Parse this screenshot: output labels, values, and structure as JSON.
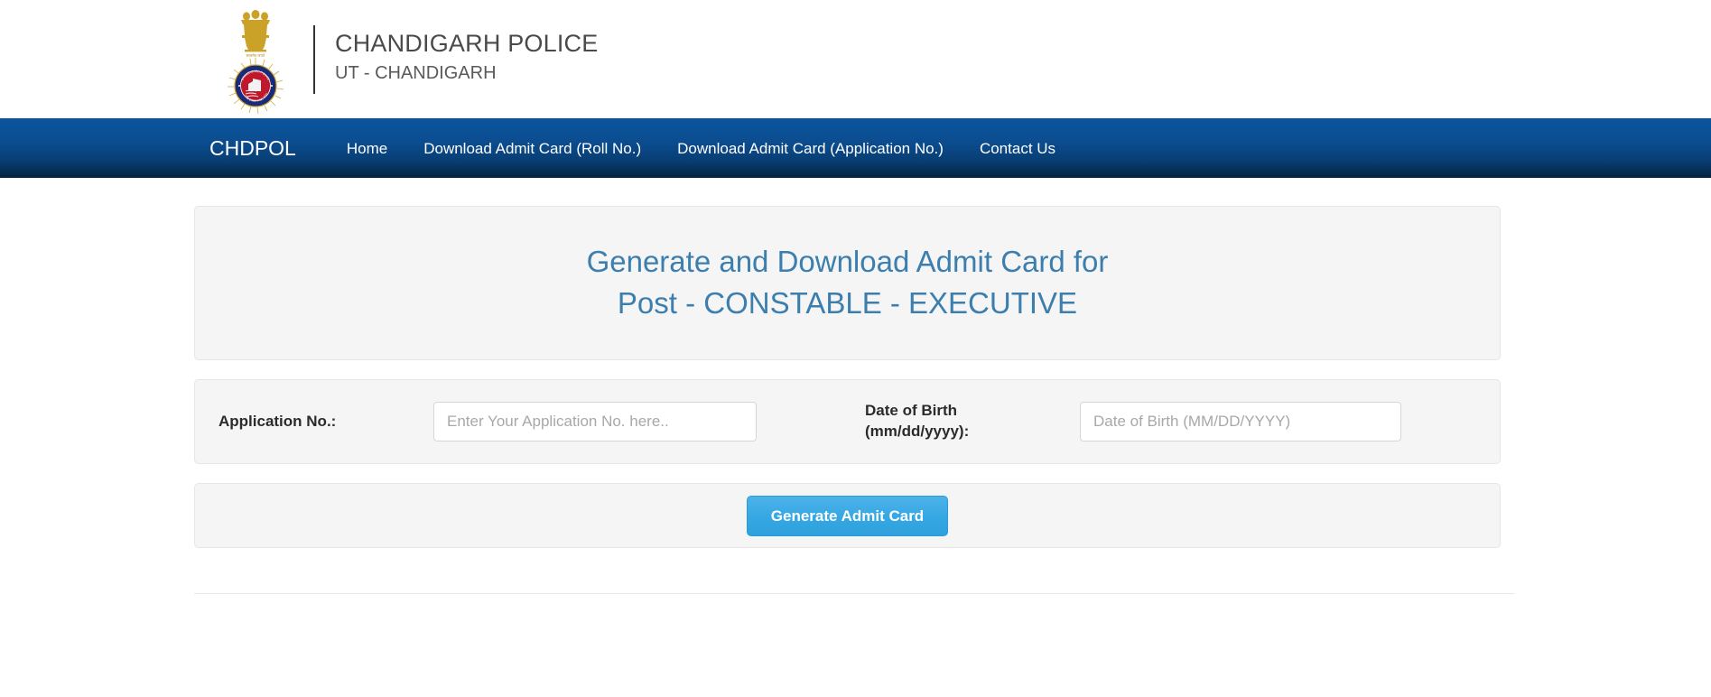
{
  "header": {
    "emblem_icon": "national-emblem-and-police-badge",
    "emblem_badge_top_text": "CHANDIGARH POLICE",
    "emblem_badge_bottom_text": "WE CARE FOR YOU",
    "org_name": "CHANDIGARH POLICE",
    "org_sub": "UT - CHANDIGARH"
  },
  "nav": {
    "brand": "CHDPOL",
    "items": [
      {
        "label": "Home"
      },
      {
        "label": "Download Admit Card (Roll No.)"
      },
      {
        "label": "Download Admit Card (Application No.)"
      },
      {
        "label": "Contact Us"
      }
    ]
  },
  "page": {
    "title_line1": "Generate and Download Admit Card for",
    "title_line2": "Post - CONSTABLE - EXECUTIVE"
  },
  "form": {
    "application_label": "Application No.:",
    "application_value": "",
    "application_placeholder": "Enter Your Application No. here..",
    "dob_label_line1": "Date of Birth",
    "dob_label_line2": "(mm/dd/yyyy):",
    "dob_value": "",
    "dob_placeholder": "Date of Birth (MM/DD/YYYY)",
    "submit_label": "Generate Admit Card"
  },
  "colors": {
    "nav_top": "#0a559f",
    "nav_bottom": "#04233f",
    "title_blue": "#3c7ead",
    "button_blue": "#35a7e2",
    "panel_bg": "#f5f5f5"
  }
}
